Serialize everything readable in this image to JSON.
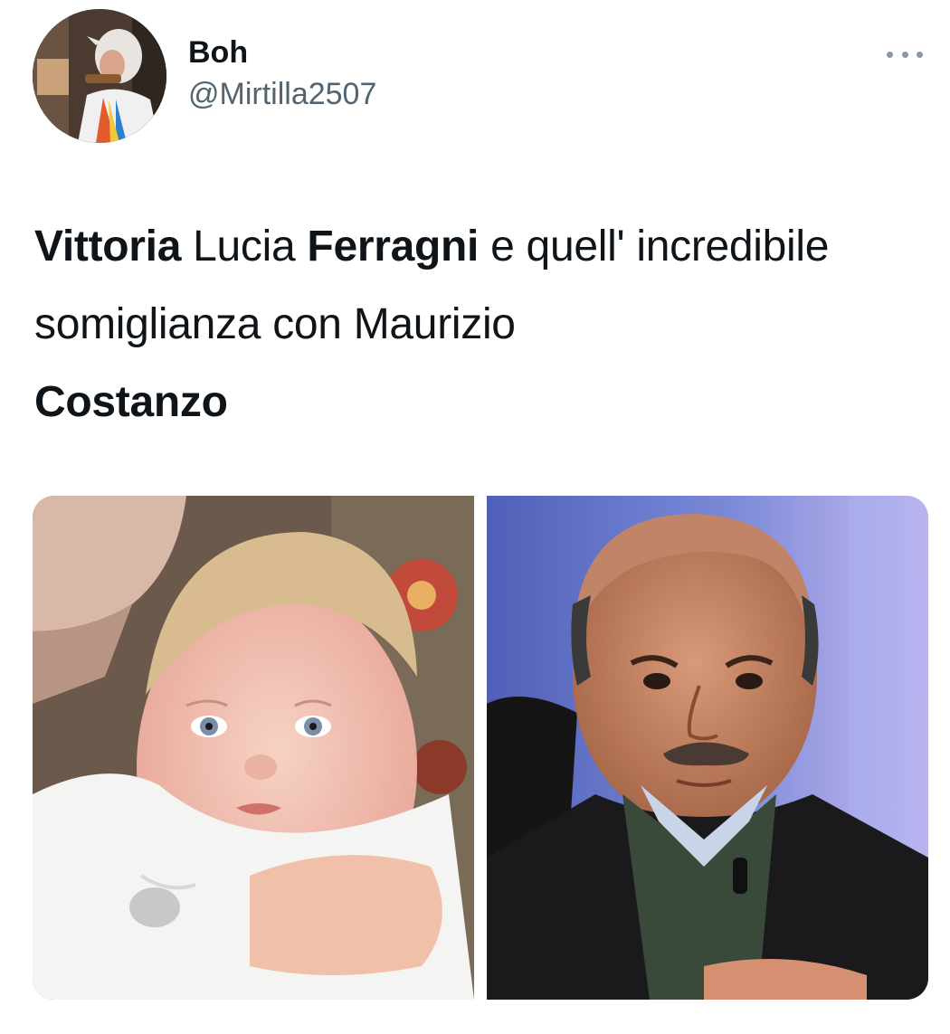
{
  "author": {
    "display_name": "Boh",
    "handle": "@Mirtilla2507"
  },
  "tweet": {
    "segments": [
      {
        "text": "Vittoria",
        "bold": true
      },
      {
        "text": " Lucia ",
        "bold": false
      },
      {
        "text": "Ferragni",
        "bold": true
      },
      {
        "text": " e quell' incredibile somiglianza con Maurizio ",
        "bold": false
      },
      {
        "text": "Costanzo",
        "bold": true
      }
    ]
  },
  "media": [
    {
      "description_icon": "baby-photo"
    },
    {
      "description_icon": "elderly-man-photo"
    }
  ],
  "colors": {
    "text_primary": "#0f1419",
    "text_secondary": "#536471"
  }
}
